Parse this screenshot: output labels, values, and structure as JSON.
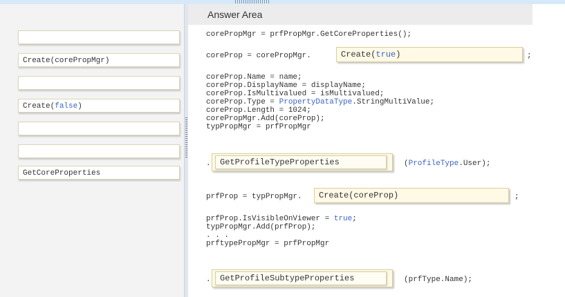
{
  "answer_area_title": "Answer Area",
  "source_items": [
    {
      "label": ""
    },
    {
      "label": "Create(corePropMgr)"
    },
    {
      "label": ""
    },
    {
      "label": "Create(false)"
    },
    {
      "label": ""
    },
    {
      "label": ""
    },
    {
      "label": "GetCoreProperties"
    }
  ],
  "code": {
    "line1": "corePropMgr = prfPropMgr.GetCoreProperties();",
    "line2_prefix": "coreProp = corePropMgr.",
    "line2_suffix": ";",
    "block": [
      "coreProp.Name = name;",
      "coreProp.DisplayName = displayName;",
      "coreProp.IsMultivalued = isMultivalued;",
      "coreProp.Type = ",
      "coreProp.Length = 1024;",
      "corePropMgr.Add(coreProp);",
      "typPropMgr = prfPropMgr"
    ],
    "type_keyword": "PropertyDataType",
    "type_suffix": ".StringMultiValue;",
    "dot1": ".",
    "line3_suffix_open": "(",
    "line3_keyword": "ProfileType",
    "line3_suffix_close": ".User);",
    "line4_prefix": "prfProp = typPropMgr.",
    "line4_suffix": ";",
    "block2_line1_prefix": "prfProp.IsVisibleOnViewer = ",
    "block2_line1_kw": "true",
    "block2_line1_suffix": ";",
    "block2_line2": "typPropMgr.Add(prfProp);",
    "block2_line3": ". . .",
    "block2_line4": "prftypePropMgr = prfPropMgr",
    "dot2": ".",
    "line5_suffix": "(prfType.Name);"
  },
  "drop_targets": {
    "create_true": "Create(true)",
    "get_profile_type_properties": "GetProfileTypeProperties",
    "create_coreprop": "Create(coreProp)",
    "get_profile_subtype_properties": "GetProfileSubtypeProperties"
  },
  "colors": {
    "keyword": "#3a63c9",
    "drop_target_bg": "#fff9e6",
    "header_bg": "#ececec"
  }
}
